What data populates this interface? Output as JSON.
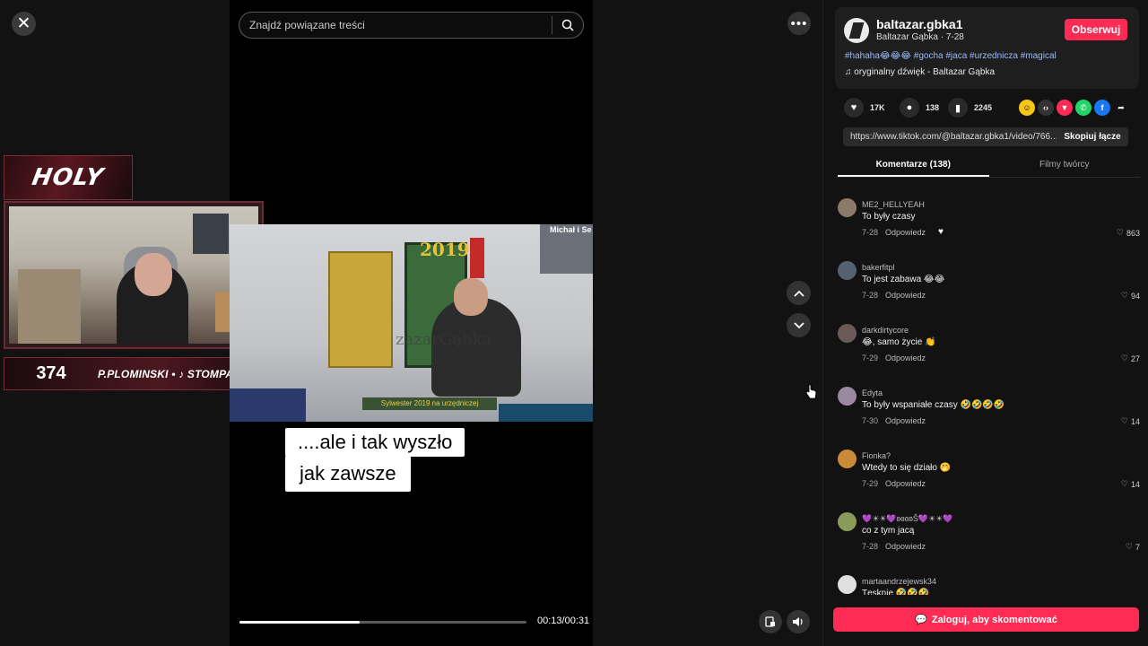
{
  "player": {
    "search_placeholder": "Znajdź powiązane treści",
    "subtitle_line1": "....ale i tak wyszło",
    "subtitle_line2": "jak zawsze",
    "time": "00:13/00:31",
    "progress": 0.42
  },
  "overlay": {
    "badge": "HOLY",
    "counter": "374",
    "socials": "P.PLOMINSKI • ♪ STOMPADRE",
    "video_watermark": "zazarGąbka",
    "video_label_2019": "2019",
    "video_corner_tag": "Michał i Se",
    "video_banner": "Sylwester 2019 na urzędniczej"
  },
  "post": {
    "handle": "baltazar.gbka1",
    "author_line": "Baltazar Gąbka · 7-28",
    "follow_label": "Obserwuj",
    "hashtags": "#hahaha😂😂😂 #gocha #jaca #urzednicza #magical",
    "sound": "♫  oryginalny dźwięk - Baltazar Gąbka",
    "likes": "17K",
    "comments": "138",
    "saves": "2245",
    "link": "https://www.tiktok.com/@baltazar.gbka1/video/766...",
    "copy_label": "Skopiuj łącze"
  },
  "tabs": [
    {
      "label": "Komentarze (138)"
    },
    {
      "label": "Filmy twórcy"
    }
  ],
  "comments": [
    {
      "user": "ME2_HELLYEAH",
      "text": "To były czasy",
      "date": "7-28",
      "reply": "Odpowiedz",
      "likes": "863",
      "avatar_color": "#8a7a6a"
    },
    {
      "user": "bakerfitpl",
      "text": "To jest zabawa 😂😂",
      "date": "7-28",
      "reply": "Odpowiedz",
      "likes": "94",
      "avatar_color": "#556070"
    },
    {
      "user": "darkdirtycore",
      "text": "😂, samo życie 👏",
      "date": "7-29",
      "reply": "Odpowiedz",
      "likes": "27",
      "avatar_color": "#6a5a5a"
    },
    {
      "user": "Edyta",
      "text": "To były wspaniałe czasy 🤣🤣🤣🤣",
      "date": "7-30",
      "reply": "Odpowiedz",
      "likes": "14",
      "avatar_color": "#9a8aa0"
    },
    {
      "user": "Fionka?",
      "text": "Wtedy to się działo 🤭",
      "date": "7-29",
      "reply": "Odpowiedz",
      "likes": "14",
      "avatar_color": "#c98a3a"
    },
    {
      "user": "💜☀☀💜ʚɞɞʚŠ💜☀☀💜",
      "text": "co z tym jacą",
      "date": "7-28",
      "reply": "Odpowiedz",
      "likes": "7",
      "avatar_color": "#8a9a5a"
    },
    {
      "user": "martaandrzejewsk34",
      "text": "Tęsknię 🤣🤣🤣",
      "date": "",
      "reply": "",
      "likes": "",
      "avatar_color": "#e0e0e0"
    }
  ],
  "login_label": "Zaloguj, aby skomentować"
}
